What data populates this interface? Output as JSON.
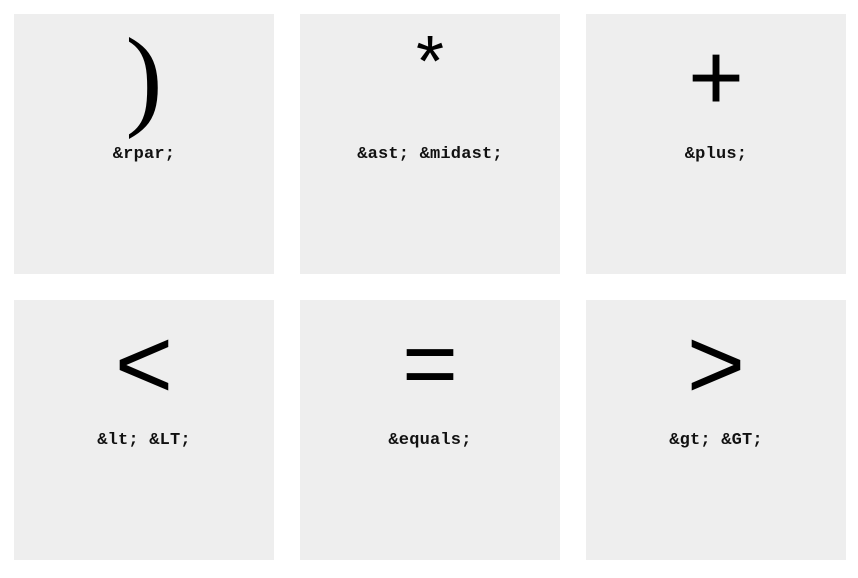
{
  "cards": [
    {
      "glyph": ")",
      "entity": "&rpar;"
    },
    {
      "glyph": "*",
      "entity": "&ast; &midast;"
    },
    {
      "glyph": "+",
      "entity": "&plus;"
    },
    {
      "glyph": "<",
      "entity": "&lt; &LT;"
    },
    {
      "glyph": "=",
      "entity": "&equals;"
    },
    {
      "glyph": ">",
      "entity": "&gt; &GT;"
    }
  ],
  "colors": {
    "card_background": "#eeeeee",
    "page_background": "#ffffff",
    "text": "#000000"
  }
}
